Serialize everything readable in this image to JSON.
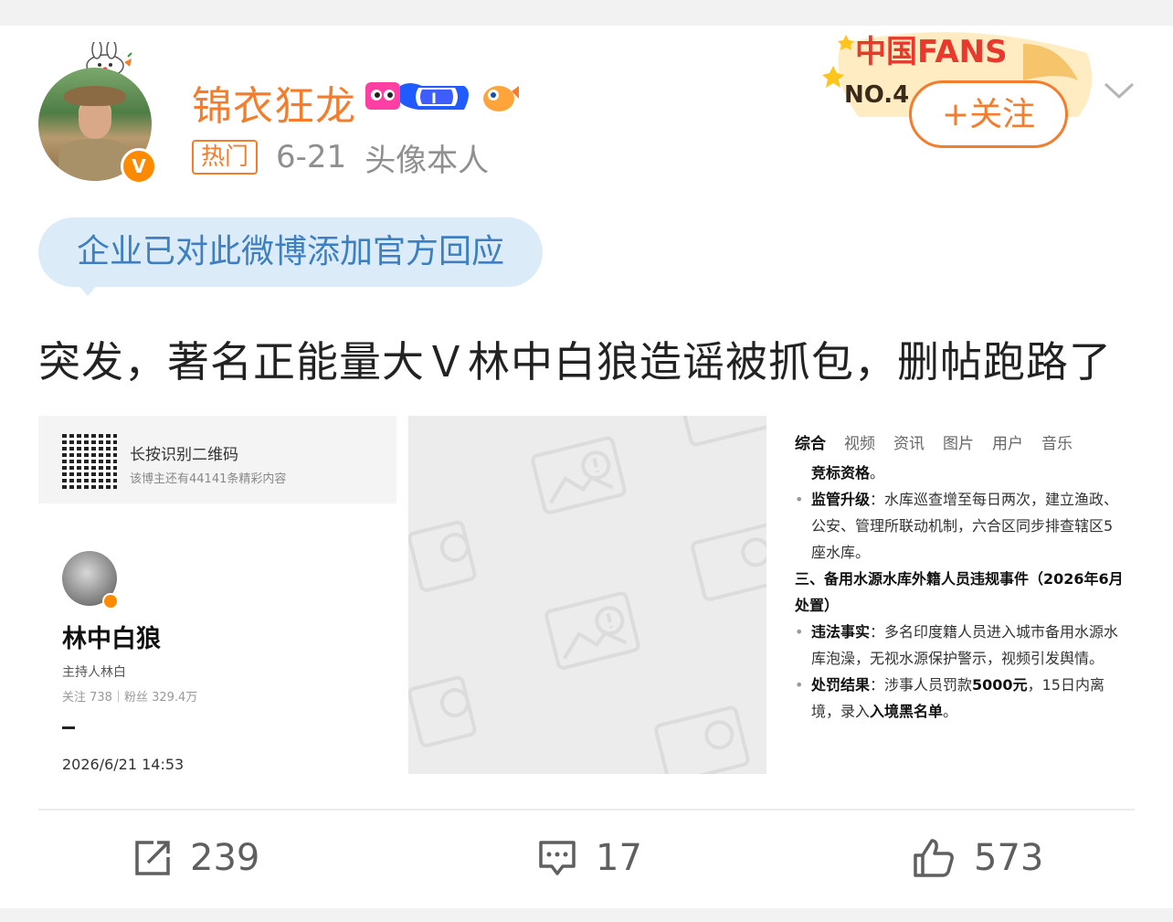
{
  "user": {
    "name": "锦衣狂龙",
    "verified_mark": "V",
    "hot_label": "热门",
    "date": "6-21",
    "source": "头像本人"
  },
  "fans_badge": {
    "line1": "中国FANS",
    "rank": "NO.4"
  },
  "follow_label": "+关注",
  "official_response": "企业已对此微博添加官方回应",
  "post_text": "突发，著名正能量大Ｖ林中白狼造谣被抓包，删帖跑路了",
  "image1": {
    "qr_title": "长按识别二维码",
    "qr_sub": "该博主还有44141条精彩内容",
    "profile_name": "林中白狼",
    "profile_desc": "主持人林白",
    "profile_stats": "关注 738｜粉丝 329.4万",
    "timestamp": "2026/6/21 14:53"
  },
  "image3": {
    "tabs": [
      "综合",
      "视频",
      "资讯",
      "图片",
      "用户",
      "音乐"
    ],
    "line0": "竞标资格",
    "line0_suffix": "。",
    "b1_label": "监管升级",
    "b1_text": "：水库巡查增至每日两次，建立渔政、公安、管理所联动机制，六合区同步排查辖区5座水库。",
    "heading": "三、备用水源水库外籍人员违规事件（2026年6月处置）",
    "b2_label": "违法事实",
    "b2_text": "：多名印度籍人员进入城市备用水源水库泡澡，无视水源保护警示，视频引发舆情。",
    "b3_label": "处罚结果",
    "b3_text_a": "：涉事人员罚款",
    "b3_bold1": "5000元",
    "b3_text_b": "，15日内离境，录入",
    "b3_bold2": "入境黑名单",
    "b3_text_c": "。"
  },
  "actions": {
    "repost": "239",
    "comment": "17",
    "like": "573"
  },
  "colors": {
    "accent": "#f37d2d",
    "official_bg": "#dbecf8",
    "official_text": "#3d7fc1"
  },
  "icons": [
    "repost-icon",
    "comment-icon",
    "like-icon",
    "chevron-down-icon",
    "image-placeholder-icon"
  ]
}
